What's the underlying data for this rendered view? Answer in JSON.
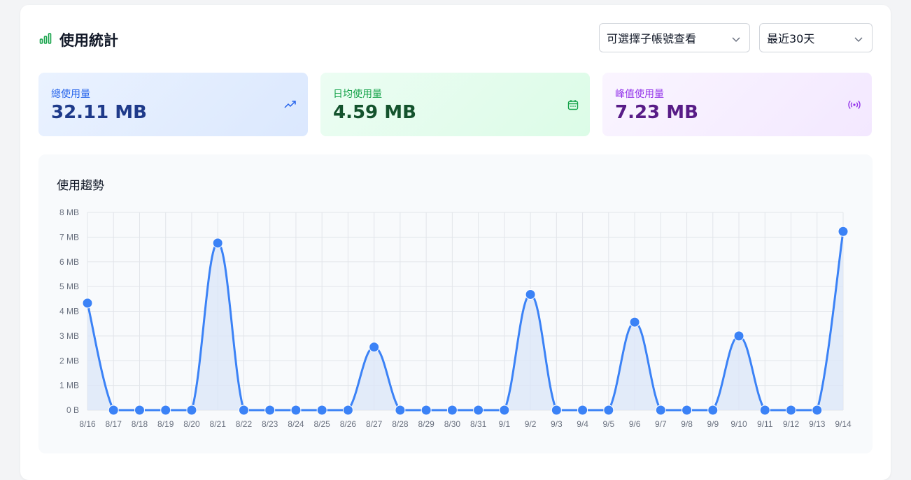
{
  "header": {
    "title": "使用統計",
    "subaccount_select": {
      "value": "可選擇子帳號查看"
    },
    "range_select": {
      "value": "最近30天"
    }
  },
  "stats": [
    {
      "label": "總使用量",
      "value": "32.11 MB",
      "icon": "trending-up-icon",
      "color": "#2563eb"
    },
    {
      "label": "日均使用量",
      "value": "4.59 MB",
      "icon": "calendar-icon",
      "color": "#16a34a"
    },
    {
      "label": "峰值使用量",
      "value": "7.23 MB",
      "icon": "broadcast-icon",
      "color": "#9333ea"
    }
  ],
  "chart": {
    "title": "使用趨勢"
  },
  "chart_data": {
    "type": "area",
    "x": [
      "8/16",
      "8/17",
      "8/18",
      "8/19",
      "8/20",
      "8/21",
      "8/22",
      "8/23",
      "8/24",
      "8/25",
      "8/26",
      "8/27",
      "8/28",
      "8/29",
      "8/30",
      "8/31",
      "9/1",
      "9/2",
      "9/3",
      "9/4",
      "9/5",
      "9/6",
      "9/7",
      "9/8",
      "9/9",
      "9/10",
      "9/11",
      "9/12",
      "9/13",
      "9/14"
    ],
    "values": [
      4.33,
      0,
      0,
      0,
      0,
      6.76,
      0,
      0,
      0,
      0,
      0,
      2.55,
      0,
      0,
      0,
      0,
      0,
      4.68,
      0,
      0,
      0,
      3.56,
      0,
      0,
      0,
      3.0,
      0,
      0,
      0,
      7.23
    ],
    "unit": "MB",
    "yticks": [
      "0 B",
      "1 MB",
      "2 MB",
      "3 MB",
      "4 MB",
      "5 MB",
      "6 MB",
      "7 MB",
      "8 MB"
    ],
    "ylim": [
      0,
      8
    ],
    "grid": true,
    "line_color": "#3b82f6",
    "fill_color": "#dbe6f8"
  }
}
